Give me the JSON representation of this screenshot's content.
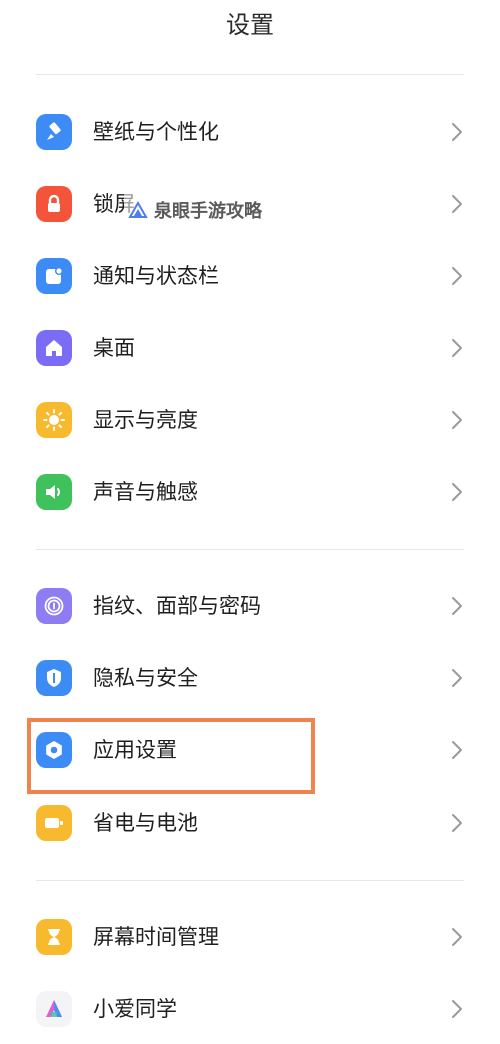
{
  "header": {
    "title": "设置"
  },
  "colors": {
    "wallpaper": "#3d8bf5",
    "lock": "#f4553a",
    "notification": "#3d8bf5",
    "desktop": "#7b6cf5",
    "display": "#f7b92d",
    "sound": "#3fc15b",
    "fingerprint": "#8e7cf2",
    "privacy": "#3d8bf5",
    "apps": "#3d8bf5",
    "battery": "#f7b92d",
    "screentime": "#f7b92d",
    "highlight": "#f0844f"
  },
  "groups": [
    {
      "items": [
        {
          "label": "壁纸与个性化",
          "icon": "brush-icon"
        },
        {
          "label": "锁屏",
          "icon": "lock-icon"
        },
        {
          "label": "通知与状态栏",
          "icon": "notification-icon"
        },
        {
          "label": "桌面",
          "icon": "home-icon"
        },
        {
          "label": "显示与亮度",
          "icon": "sun-icon"
        },
        {
          "label": "声音与触感",
          "icon": "speaker-icon"
        }
      ]
    },
    {
      "items": [
        {
          "label": "指纹、面部与密码",
          "icon": "fingerprint-icon"
        },
        {
          "label": "隐私与安全",
          "icon": "shield-icon"
        },
        {
          "label": "应用设置",
          "icon": "app-settings-icon"
        },
        {
          "label": "省电与电池",
          "icon": "battery-icon"
        }
      ]
    },
    {
      "items": [
        {
          "label": "屏幕时间管理",
          "icon": "hourglass-icon"
        },
        {
          "label": "小爱同学",
          "icon": "assistant-icon"
        }
      ]
    }
  ],
  "watermark": {
    "text": "泉眼手游攻略"
  }
}
